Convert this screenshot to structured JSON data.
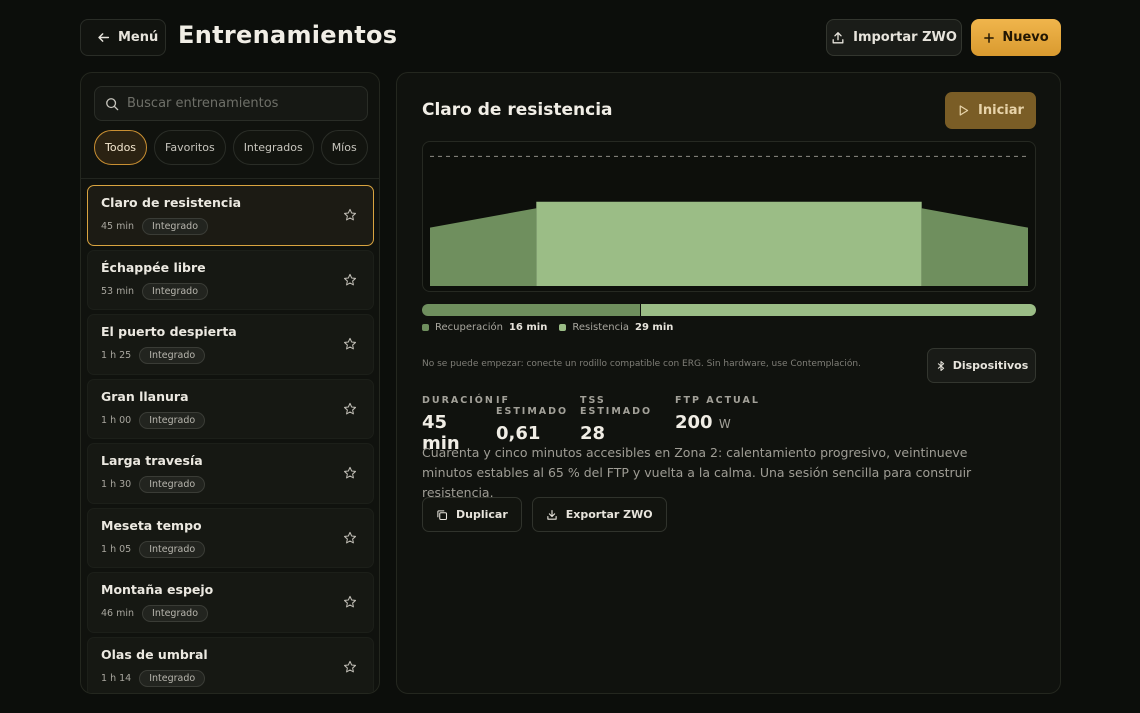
{
  "header": {
    "back_label": "Menú",
    "title": "Entrenamientos",
    "import_label": "Importar ZWO",
    "new_label": "Nuevo"
  },
  "sidebar": {
    "search_placeholder": "Buscar entrenamientos",
    "filters": [
      "Todos",
      "Favoritos",
      "Integrados",
      "Míos"
    ],
    "active_filter": "Todos",
    "items": [
      {
        "title": "Claro de resistencia",
        "duration": "45 min",
        "badge": "Integrado",
        "selected": true
      },
      {
        "title": "Échappée libre",
        "duration": "53 min",
        "badge": "Integrado"
      },
      {
        "title": "El puerto despierta",
        "duration": "1 h 25",
        "badge": "Integrado"
      },
      {
        "title": "Gran llanura",
        "duration": "1 h 00",
        "badge": "Integrado"
      },
      {
        "title": "Larga travesía",
        "duration": "1 h 30",
        "badge": "Integrado"
      },
      {
        "title": "Meseta tempo",
        "duration": "1 h 05",
        "badge": "Integrado"
      },
      {
        "title": "Montaña espejo",
        "duration": "46 min",
        "badge": "Integrado"
      },
      {
        "title": "Olas de umbral",
        "duration": "1 h 14",
        "badge": "Integrado"
      }
    ]
  },
  "detail": {
    "title": "Claro de resistencia",
    "start_label": "Iniciar",
    "zones": [
      {
        "name": "Recuperación",
        "duration": "16 min",
        "minutes": 16,
        "color": "#6f8f5e"
      },
      {
        "name": "Resistencia",
        "duration": "29 min",
        "minutes": 29,
        "color": "#9bbd86"
      }
    ],
    "note": "No se puede empezar: conecte un rodillo compatible con ERG. Sin hardware, use Contemplación.",
    "devices_label": "Dispositivos",
    "stats": [
      {
        "label": "DURACIÓN",
        "value": "45 min",
        "unit": ""
      },
      {
        "label": "IF ESTIMADO",
        "value": "0,61",
        "unit": ""
      },
      {
        "label": "TSS ESTIMADO",
        "value": "28",
        "unit": ""
      },
      {
        "label": "FTP ACTUAL",
        "value": "200",
        "unit": "W"
      }
    ],
    "description": "Cuarenta y cinco minutos accesibles en Zona 2: calentamiento progresivo, veintinueve minutos estables al 65 % del FTP y vuelta a la calma. Una sesión sencilla para construir resistencia.",
    "duplicate_label": "Duplicar",
    "export_label": "Exportar ZWO"
  },
  "chart_data": {
    "type": "area",
    "x_unit": "min",
    "ftp_line": 1.0,
    "segments": [
      {
        "start": 0,
        "end": 8,
        "from": 0.45,
        "to": 0.6,
        "zone": "Recuperación"
      },
      {
        "start": 8,
        "end": 37,
        "from": 0.65,
        "to": 0.65,
        "zone": "Resistencia"
      },
      {
        "start": 37,
        "end": 45,
        "from": 0.6,
        "to": 0.45,
        "zone": "Recuperación"
      }
    ],
    "xlim": [
      0,
      45
    ],
    "ylim": [
      0,
      1.08
    ]
  },
  "colors": {
    "accent": "#e2a63c",
    "recovery": "#6f8f5e",
    "endurance": "#9bbd86"
  }
}
